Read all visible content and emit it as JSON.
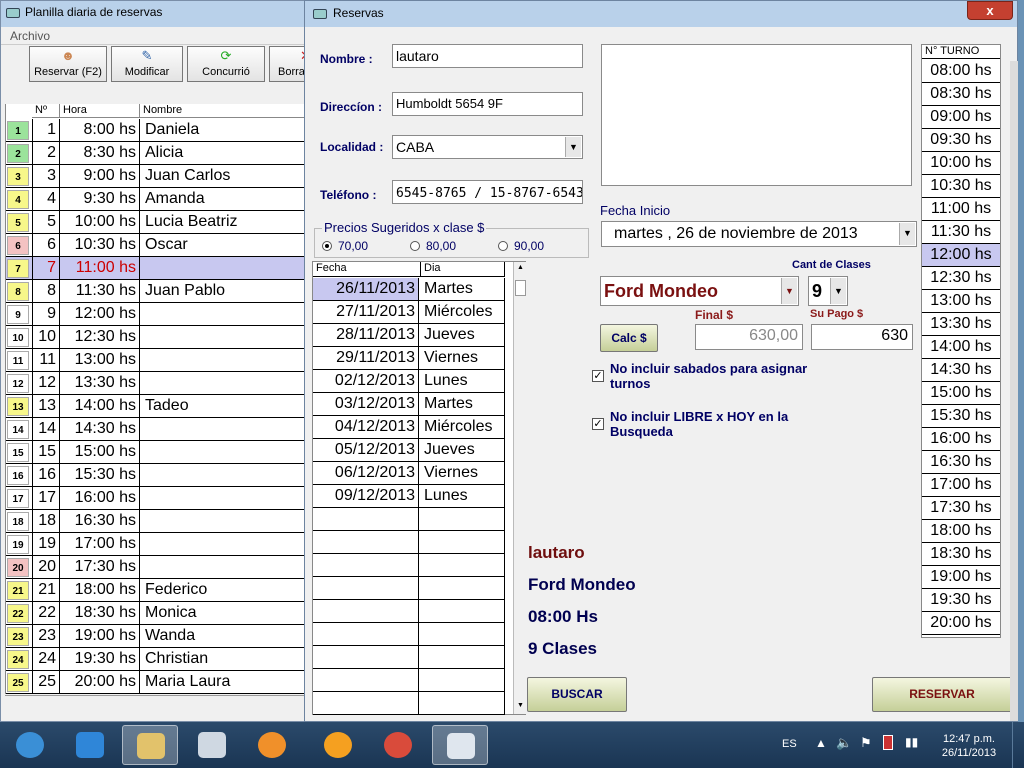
{
  "bgwin": {
    "title": "Planilla diaria de reservas",
    "menu": "Archivo",
    "toolbar": [
      "Reservar (F2)",
      "Modificar",
      "Concurrió",
      "Borra"
    ],
    "headers": [
      "Nº",
      "Hora",
      "Nombre"
    ],
    "rows": [
      {
        "ind": "1",
        "n": "1",
        "hora": "8:00 hs",
        "nombre": "Daniela",
        "color": "#9be39b"
      },
      {
        "ind": "2",
        "n": "2",
        "hora": "8:30 hs",
        "nombre": "Alicia",
        "color": "#9be39b"
      },
      {
        "ind": "3",
        "n": "3",
        "hora": "9:00 hs",
        "nombre": "Juan Carlos",
        "color": "#f7f78a"
      },
      {
        "ind": "4",
        "n": "4",
        "hora": "9:30 hs",
        "nombre": "Amanda",
        "color": "#f7f78a"
      },
      {
        "ind": "5",
        "n": "5",
        "hora": "10:00 hs",
        "nombre": "Lucia Beatriz",
        "color": "#f7f78a"
      },
      {
        "ind": "6",
        "n": "6",
        "hora": "10:30 hs",
        "nombre": "Oscar",
        "color": "#f4c2c2"
      },
      {
        "ind": "7",
        "n": "7",
        "hora": "11:00 hs",
        "nombre": "",
        "color": "#f7f78a",
        "sel": true
      },
      {
        "ind": "8",
        "n": "8",
        "hora": "11:30 hs",
        "nombre": "Juan Pablo",
        "color": "#f7f78a"
      },
      {
        "ind": "9",
        "n": "9",
        "hora": "12:00 hs",
        "nombre": "",
        "color": "#ffffff"
      },
      {
        "ind": "10",
        "n": "10",
        "hora": "12:30 hs",
        "nombre": "",
        "color": "#ffffff"
      },
      {
        "ind": "11",
        "n": "11",
        "hora": "13:00 hs",
        "nombre": "",
        "color": "#ffffff"
      },
      {
        "ind": "12",
        "n": "12",
        "hora": "13:30 hs",
        "nombre": "",
        "color": "#ffffff"
      },
      {
        "ind": "13",
        "n": "13",
        "hora": "14:00 hs",
        "nombre": "Tadeo",
        "color": "#f7f78a"
      },
      {
        "ind": "14",
        "n": "14",
        "hora": "14:30 hs",
        "nombre": "",
        "color": "#ffffff"
      },
      {
        "ind": "15",
        "n": "15",
        "hora": "15:00 hs",
        "nombre": "",
        "color": "#ffffff"
      },
      {
        "ind": "16",
        "n": "16",
        "hora": "15:30 hs",
        "nombre": "",
        "color": "#ffffff"
      },
      {
        "ind": "17",
        "n": "17",
        "hora": "16:00 hs",
        "nombre": "",
        "color": "#ffffff"
      },
      {
        "ind": "18",
        "n": "18",
        "hora": "16:30 hs",
        "nombre": "",
        "color": "#ffffff"
      },
      {
        "ind": "19",
        "n": "19",
        "hora": "17:00 hs",
        "nombre": "",
        "color": "#ffffff"
      },
      {
        "ind": "20",
        "n": "20",
        "hora": "17:30 hs",
        "nombre": "",
        "color": "#f4c2c2"
      },
      {
        "ind": "21",
        "n": "21",
        "hora": "18:00 hs",
        "nombre": "Federico",
        "color": "#f7f78a"
      },
      {
        "ind": "22",
        "n": "22",
        "hora": "18:30 hs",
        "nombre": "Monica",
        "color": "#f7f78a"
      },
      {
        "ind": "23",
        "n": "23",
        "hora": "19:00 hs",
        "nombre": "Wanda",
        "color": "#f7f78a"
      },
      {
        "ind": "24",
        "n": "24",
        "hora": "19:30 hs",
        "nombre": "Christian",
        "color": "#f7f78a"
      },
      {
        "ind": "25",
        "n": "25",
        "hora": "20:00 hs",
        "nombre": "Maria Laura",
        "color": "#f7f78a"
      }
    ]
  },
  "dlg": {
    "title": "Reservas",
    "close": "x",
    "nombre_label": "Nombre :",
    "nombre_value": "lautaro",
    "direccion_label": "Direccíon :",
    "direccion_value": "Humboldt 5654  9F",
    "localidad_label": "Localidad :",
    "localidad_value": "CABA",
    "telefono_label": "Teléfono :",
    "telefono_value": "6545-8765  / 15-8767-6543",
    "precios_label": "Precios Sugeridos x clase  $",
    "precios": [
      "70,00",
      "80,00",
      "90,00"
    ],
    "precio_selected": 0,
    "date_headers": [
      "Fecha",
      "Dia"
    ],
    "dates": [
      {
        "fecha": "26/11/2013",
        "dia": "Martes",
        "sel": true
      },
      {
        "fecha": "27/11/2013",
        "dia": "Miércoles"
      },
      {
        "fecha": "28/11/2013",
        "dia": "Jueves"
      },
      {
        "fecha": "29/11/2013",
        "dia": "Viernes"
      },
      {
        "fecha": "02/12/2013",
        "dia": "Lunes"
      },
      {
        "fecha": "03/12/2013",
        "dia": "Martes"
      },
      {
        "fecha": "04/12/2013",
        "dia": "Miércoles"
      },
      {
        "fecha": "05/12/2013",
        "dia": "Jueves"
      },
      {
        "fecha": "06/12/2013",
        "dia": "Viernes"
      },
      {
        "fecha": "09/12/2013",
        "dia": "Lunes"
      }
    ],
    "fecha_inicio_label": "Fecha Inicio",
    "fecha_inicio_value": "martes  , 26 de  noviembre  de 2013",
    "cant_clases_label": "Cant de Clases",
    "auto_value": "Ford Mondeo",
    "cant_value": "9",
    "calc_label": "Calc $",
    "final_label": "Final $",
    "final_value": "630,00",
    "supago_label": "Su Pago $",
    "supago_value": "630",
    "opt1": "No incluir sabados para asignar turnos",
    "opt2": "No incluir LIBRE x HOY en la Busqueda",
    "summary_name": "lautaro",
    "summary_car": "Ford Mondeo",
    "summary_time": "08:00 Hs",
    "summary_classes": "9  Clases",
    "buscar_label": "BUSCAR",
    "reservar_label": "RESERVAR",
    "turno_header": "N° TURNO",
    "turnos": [
      "08:00 hs",
      "08:30 hs",
      "09:00 hs",
      "09:30 hs",
      "10:00 hs",
      "10:30 hs",
      "11:00 hs",
      "11:30 hs",
      "12:00 hs",
      "12:30 hs",
      "13:00 hs",
      "13:30 hs",
      "14:00 hs",
      "14:30 hs",
      "15:00 hs",
      "15:30 hs",
      "16:00 hs",
      "16:30 hs",
      "17:00 hs",
      "17:30 hs",
      "18:00 hs",
      "18:30 hs",
      "19:00 hs",
      "19:30 hs",
      "20:00 hs"
    ],
    "turno_selected": 8
  },
  "taskbar": {
    "lang": "ES",
    "time": "12:47 p.m.",
    "date": "26/11/2013",
    "apps": [
      {
        "icon": "windows-start-icon",
        "color": "#3a8fd6"
      },
      {
        "icon": "internet-explorer-icon",
        "color": "#2f86d8"
      },
      {
        "icon": "file-explorer-icon",
        "color": "#e2c26b"
      },
      {
        "icon": "calculator-icon",
        "color": "#cfd8e2"
      },
      {
        "icon": "media-player-icon",
        "color": "#f0902a"
      },
      {
        "icon": "orange-app-icon",
        "color": "#f5a020"
      },
      {
        "icon": "chrome-icon",
        "color": "#d94b3b"
      },
      {
        "icon": "reservas-app-icon",
        "color": "#dfe6ee"
      }
    ]
  }
}
